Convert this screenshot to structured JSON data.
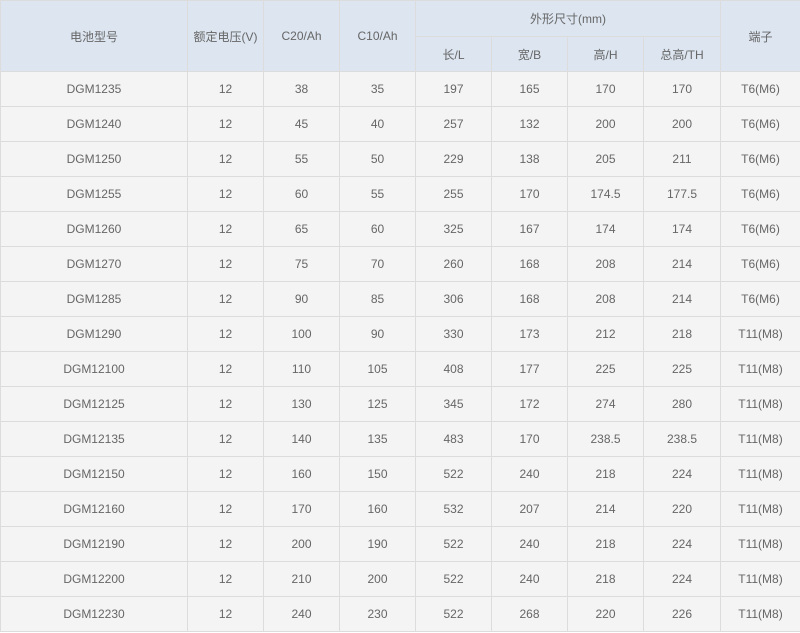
{
  "table": {
    "headers": {
      "model": "电池型号",
      "voltage": "额定电压(V)",
      "c20": "C20/Ah",
      "c10": "C10/Ah",
      "dimensions": "外形尺寸(mm)",
      "length": "长/L",
      "width": "宽/B",
      "height": "高/H",
      "total_height": "总高/TH",
      "terminal": "端子"
    },
    "rows": [
      [
        "DGM1235",
        "12",
        "38",
        "35",
        "197",
        "165",
        "170",
        "170",
        "T6(M6)"
      ],
      [
        "DGM1240",
        "12",
        "45",
        "40",
        "257",
        "132",
        "200",
        "200",
        "T6(M6)"
      ],
      [
        "DGM1250",
        "12",
        "55",
        "50",
        "229",
        "138",
        "205",
        "211",
        "T6(M6)"
      ],
      [
        "DGM1255",
        "12",
        "60",
        "55",
        "255",
        "170",
        "174.5",
        "177.5",
        "T6(M6)"
      ],
      [
        "DGM1260",
        "12",
        "65",
        "60",
        "325",
        "167",
        "174",
        "174",
        "T6(M6)"
      ],
      [
        "DGM1270",
        "12",
        "75",
        "70",
        "260",
        "168",
        "208",
        "214",
        "T6(M6)"
      ],
      [
        "DGM1285",
        "12",
        "90",
        "85",
        "306",
        "168",
        "208",
        "214",
        "T6(M6)"
      ],
      [
        "DGM1290",
        "12",
        "100",
        "90",
        "330",
        "173",
        "212",
        "218",
        "T11(M8)"
      ],
      [
        "DGM12100",
        "12",
        "110",
        "105",
        "408",
        "177",
        "225",
        "225",
        "T11(M8)"
      ],
      [
        "DGM12125",
        "12",
        "130",
        "125",
        "345",
        "172",
        "274",
        "280",
        "T11(M8)"
      ],
      [
        "DGM12135",
        "12",
        "140",
        "135",
        "483",
        "170",
        "238.5",
        "238.5",
        "T11(M8)"
      ],
      [
        "DGM12150",
        "12",
        "160",
        "150",
        "522",
        "240",
        "218",
        "224",
        "T11(M8)"
      ],
      [
        "DGM12160",
        "12",
        "170",
        "160",
        "532",
        "207",
        "214",
        "220",
        "T11(M8)"
      ],
      [
        "DGM12190",
        "12",
        "200",
        "190",
        "522",
        "240",
        "218",
        "224",
        "T11(M8)"
      ],
      [
        "DGM12200",
        "12",
        "210",
        "200",
        "522",
        "240",
        "218",
        "224",
        "T11(M8)"
      ],
      [
        "DGM12230",
        "12",
        "240",
        "230",
        "522",
        "268",
        "220",
        "226",
        "T11(M8)"
      ]
    ]
  }
}
